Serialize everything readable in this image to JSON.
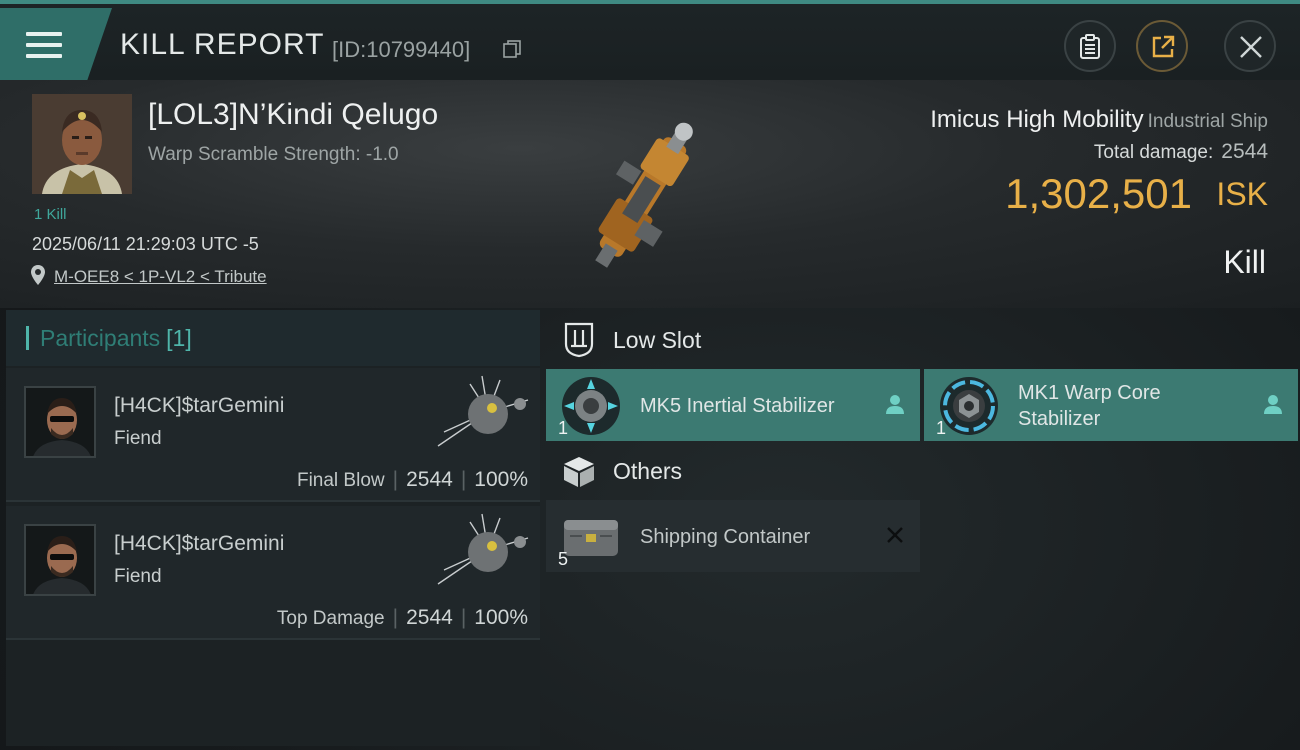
{
  "window": {
    "title": "KILL REPORT",
    "report_id": "[ID:10799440]"
  },
  "victim": {
    "name": "[LOL3]N’Kindi Qelugo",
    "warp_scramble": "Warp Scramble Strength: -1.0",
    "kill_count": "1 Kill",
    "timestamp": "2025/06/11 21:29:03 UTC -5",
    "location": "M-OEE8 < 1P-VL2 < Tribute"
  },
  "ship": {
    "name": "Imicus High Mobility",
    "class": "Industrial Ship",
    "total_damage_label": "Total damage:",
    "total_damage": "2544",
    "value": "1,302,501",
    "currency": "ISK",
    "result": "Kill"
  },
  "participants": {
    "title": "Participants",
    "count": "[1]",
    "items": [
      {
        "name": "[H4CK]$tarGemini",
        "ship": "Fiend",
        "role": "Final Blow",
        "damage": "2544",
        "percent": "100%"
      },
      {
        "name": "[H4CK]$tarGemini",
        "ship": "Fiend",
        "role": "Top Damage",
        "damage": "2544",
        "percent": "100%"
      }
    ]
  },
  "low_slot": {
    "title": "Low Slot",
    "items": [
      {
        "name": "MK5 Inertial Stabilizer",
        "qty": "1",
        "status_icon": "person-icon"
      },
      {
        "name_line1": "MK1 Warp Core",
        "name_line2": "Stabilizer",
        "qty": "1",
        "status_icon": "person-icon"
      }
    ]
  },
  "others": {
    "title": "Others",
    "items": [
      {
        "name": "Shipping Container",
        "qty": "5",
        "status_icon": "destroyed-x-icon"
      }
    ]
  },
  "colors": {
    "accent_teal": "#3c7a72",
    "isk_gold": "#e8b048",
    "participants_teal": "#4fb5aa"
  }
}
